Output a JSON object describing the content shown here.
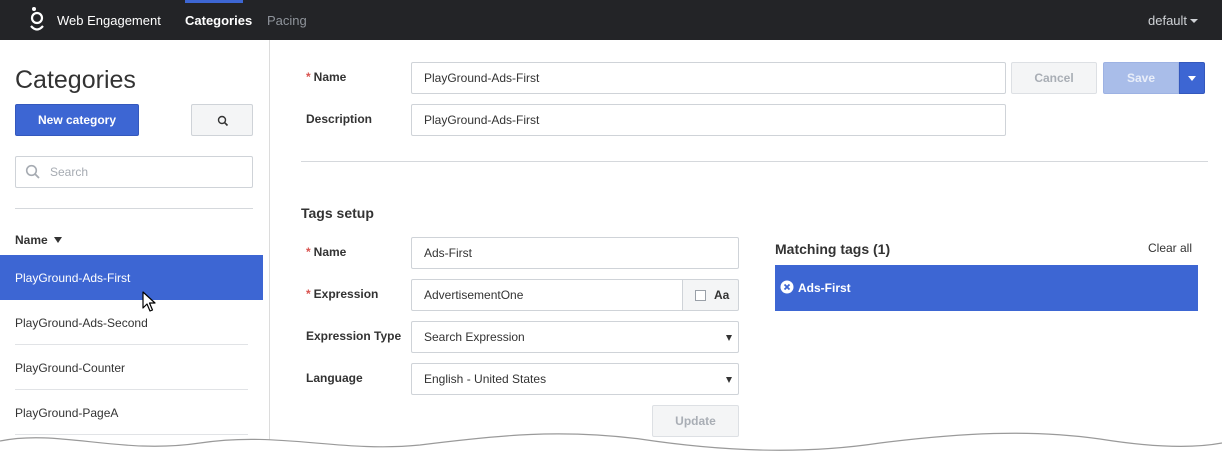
{
  "header": {
    "app_title": "Web Engagement",
    "nav": [
      {
        "label": "Categories",
        "active": true
      },
      {
        "label": "Pacing",
        "active": false
      }
    ],
    "user_menu": "default",
    "accent_color": "#3d66d3",
    "bar_color": "#232427"
  },
  "sidebar": {
    "title": "Categories",
    "new_button": "New category",
    "search_placeholder": "Search",
    "column_header": "Name",
    "sort_icon": "caret-down-icon",
    "items": [
      {
        "label": "PlayGround-Ads-First",
        "selected": true
      },
      {
        "label": "PlayGround-Ads-Second",
        "selected": false
      },
      {
        "label": "PlayGround-Counter",
        "selected": false
      },
      {
        "label": "PlayGround-PageA",
        "selected": false
      }
    ]
  },
  "form": {
    "name_label": "Name",
    "name_value": "PlayGround-Ads-First",
    "description_label": "Description",
    "description_value": "PlayGround-Ads-First",
    "cancel_label": "Cancel",
    "save_label": "Save",
    "required_marker": "*"
  },
  "tags_setup": {
    "title": "Tags setup",
    "name_label": "Name",
    "name_value": "Ads-First",
    "expression_label": "Expression",
    "expression_value": "AdvertisementOne",
    "case_toggle_label": "Aa",
    "expression_type_label": "Expression Type",
    "expression_type_value": "Search Expression",
    "language_label": "Language",
    "language_value": "English - United States",
    "update_label": "Update"
  },
  "matching_tags": {
    "title": "Matching tags (1)",
    "clear_all": "Clear all",
    "tags": [
      {
        "label": "Ads-First"
      }
    ]
  }
}
